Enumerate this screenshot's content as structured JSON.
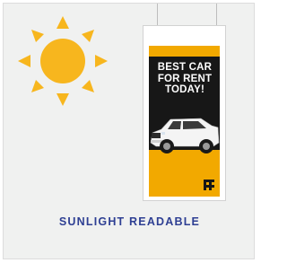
{
  "caption": "SUNLIGHT READABLE",
  "poster": {
    "headline_lines": [
      "BEST CAR",
      "FOR RENT",
      "TODAY!"
    ]
  },
  "colors": {
    "sun": "#f7b61e",
    "poster_accent": "#f2a900",
    "poster_dark": "#171717",
    "caption": "#2e3f93",
    "background": "#f0f1f0"
  },
  "icons": {
    "sun": "sun-icon",
    "car": "suv-car"
  }
}
